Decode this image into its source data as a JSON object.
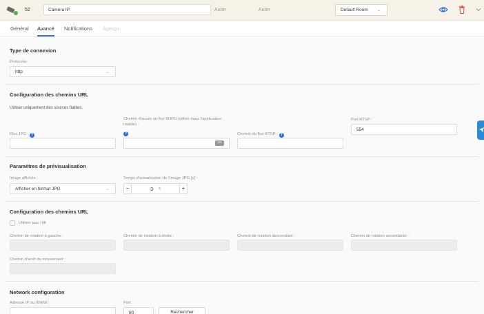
{
  "header": {
    "device_id": "52",
    "device_name": "Caméra IP",
    "type_primary": "Autre",
    "type_secondary": "Autre",
    "room": "Default Room",
    "icons": [
      "camera-device-icon",
      "eye-icon",
      "trash-icon",
      "chevron-down-icon"
    ],
    "colors": {
      "eye": "#2f6fd6",
      "trash": "#d9534f",
      "header_bg": "#f7f2e8"
    }
  },
  "tabs": [
    {
      "label": "Général",
      "state": "normal"
    },
    {
      "label": "Avancé",
      "state": "active"
    },
    {
      "label": "Notifications",
      "state": "normal"
    },
    {
      "label": "Aperçu",
      "state": "disabled"
    }
  ],
  "connection": {
    "title": "Type de connexion",
    "protocol_label": "Protocole:",
    "protocol_value": "http"
  },
  "url_paths": {
    "title": "Configuration des chemins URL",
    "note": "Utiliser uniquement des sources fiables.",
    "jpg_label": "Flux JPG :",
    "jpg_value": "",
    "mjpg_label": "Chemin d'accès au flux MJPG (utilisé dans l'application mobile) :",
    "mjpg_value": "",
    "rtsp_path_label": "Chemin du flux RTSP :",
    "rtsp_path_value": "",
    "rtsp_port_label": "Port RTSP :",
    "rtsp_port_value": "554",
    "dots": "•••"
  },
  "preview": {
    "title": "Paramètres de prévisualisation",
    "image_label": "Image affichée :",
    "image_value": "Afficher en format JPG",
    "refresh_label": "Temps d'actualisation de l'image JPG [s] :",
    "refresh_value": "3",
    "refresh_unit": "s",
    "minus": "−",
    "plus": "+"
  },
  "pan_tilt": {
    "title": "Configuration des chemins URL",
    "checkbox_label": "Utiliser pan / tilt",
    "checked": false,
    "rotate_left_label": "Chemin de rotation à gauche :",
    "rotate_right_label": "Chemin de rotation à droite :",
    "rotate_down_label": "Chemin de rotation descendant :",
    "rotate_up_label": "Chemin de rotation ascendante :",
    "stop_label": "Chemin d'arrêt du mouvement :"
  },
  "network": {
    "title": "Network configuration",
    "address_label": "Adresse IP ou WWW :",
    "address_value": "",
    "port_label": "Port :",
    "port_value": "80",
    "search_button": "Rechercher"
  }
}
